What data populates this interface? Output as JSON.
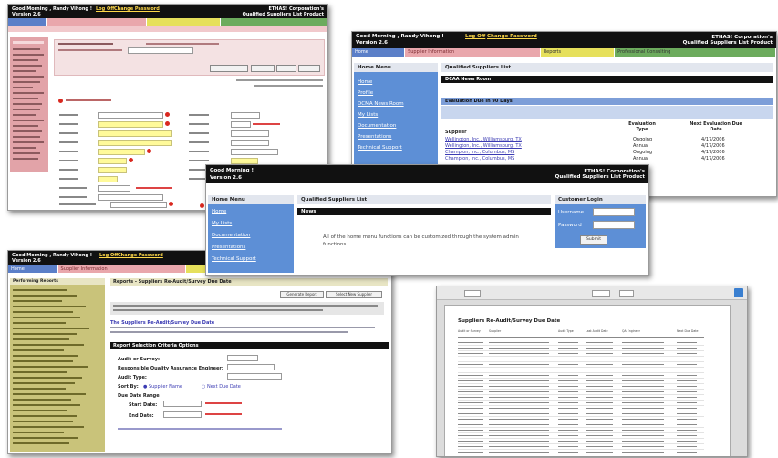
{
  "window_edit": {
    "greeting": "Good Morning , Randy Vihong !",
    "version": "Version 2.6",
    "links": [
      "Log Off",
      "Change Password"
    ],
    "corp": [
      "ETHAS! Corporation's",
      "Qualified Suppliers List Product"
    ]
  },
  "window_qsl": {
    "greeting": "Good Morning , Randy Vihong !",
    "version": "Version 2.6",
    "links": [
      "Log Off",
      "Change Password"
    ],
    "corp": [
      "ETHAS! Corporation's",
      "Qualified Suppliers List Product"
    ],
    "menu": [
      "Home",
      "Supplier Information",
      "Reports",
      "Professional Consulting"
    ],
    "sidebar_title": "Home Menu",
    "sidebar_items": [
      "Home",
      "Profile",
      "DCMA News Room",
      "My Lists",
      "Documentation",
      "Presentations",
      "Technical Support"
    ],
    "main_title": "Qualified Suppliers List",
    "dark_bar_text": "DCAA News Room",
    "eval_title": "Evaluation Due in 90 Days",
    "col_headers": [
      "Supplier",
      "Evaluation Type",
      "Next Evaluation Due Date"
    ],
    "rows": [
      {
        "supplier": "Wellington, Inc., Williamsburg, TX",
        "type": "Ongoing",
        "date": "4/17/2006"
      },
      {
        "supplier": "Wellington, Inc., Williamsburg, TX",
        "type": "Annual",
        "date": "4/17/2006"
      },
      {
        "supplier": "Champion, Inc., Columbus, MS",
        "type": "Ongoing",
        "date": "4/17/2006"
      },
      {
        "supplier": "Champion, Inc., Columbus, MS",
        "type": "Annual",
        "date": "4/17/2006"
      }
    ]
  },
  "window_login": {
    "greeting": "Good Morning !",
    "version": "Version 2.6",
    "corp": [
      "ETHAS! Corporation's",
      "Qualified Suppliers List Product"
    ],
    "sidebar_title": "Home Menu",
    "sidebar_items": [
      "Home",
      "My Lists",
      "Documentation",
      "Presentations",
      "Technical Support"
    ],
    "main_title": "Qualified Suppliers List",
    "dark_bar_text": "News",
    "notice": "All of the home menu functions can be customized through the system admin functions.",
    "login_title": "Customer Login",
    "username_label": "Username",
    "password_label": "Password",
    "submit_label": "Submit"
  },
  "window_reports": {
    "greeting": "Good Morning , Randy Vihong !",
    "version": "Version 2.6",
    "links": [
      "Log Off",
      "Change Password"
    ],
    "menu": [
      "Home",
      "Supplier Information"
    ],
    "sidebar_title": "Performing Reports",
    "main_title": "Reports - Suppliers Re-Audit/Survey Due Date",
    "intro_bold": "The Suppliers Re-Audit/Survey Due Date",
    "section_title": "Report Selection Criteria Options",
    "criteria_labels": [
      "Audit or Survey:",
      "Responsible Quality Assurance Engineer:",
      "Audit Type:",
      "Sort By:",
      "Due Date Range",
      "Start Date:",
      "End Date:"
    ],
    "sort_options": [
      "Supplier Name",
      "Next Due Date"
    ],
    "buttons": [
      "Generate Report",
      "Select New Supplier"
    ]
  },
  "window_document": {
    "report_title": "Suppliers Re-Audit/Survey Due Date",
    "col_headers": [
      "Audit or Survey",
      "Supplier",
      "Audit Type",
      "Last Audit Date",
      "QA Engineer",
      "Next Due Date"
    ]
  },
  "colors": {
    "menu_blue": "#5b7fc8",
    "menu_pink": "#e9a7ac",
    "menu_yellow": "#e6e05b",
    "menu_green": "#6cab5d",
    "sidebar_blue": "#5d8fd6",
    "sidebar_olive": "#c9c37a",
    "required_red": "#d9281f"
  }
}
